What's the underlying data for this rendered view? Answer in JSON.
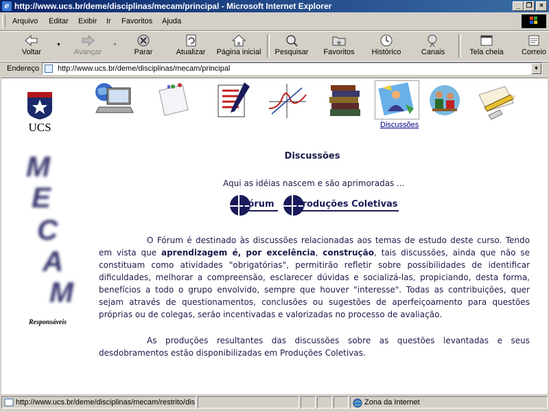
{
  "window": {
    "title": "http://www.ucs.br/deme/disciplinas/mecam/principal - Microsoft Internet Explorer",
    "controls": [
      "_",
      "❐",
      "×"
    ]
  },
  "menu": [
    "Arquivo",
    "Editar",
    "Exibir",
    "Ir",
    "Favoritos",
    "Ajuda"
  ],
  "toolbar": {
    "back": "Voltar",
    "forward": "Avançar",
    "stop": "Parar",
    "refresh": "Atualizar",
    "home": "Página inicial",
    "search": "Pesquisar",
    "favorites": "Favoritos",
    "history": "Histórico",
    "channels": "Canais",
    "fullscreen": "Tela cheia",
    "mail": "Correio"
  },
  "address": {
    "label": "Endereço",
    "url": "http://www.ucs.br/deme/disciplinas/mecam/principal"
  },
  "page": {
    "logo_text": "UCS",
    "side_title_letters": [
      "M",
      "E",
      "C",
      "A",
      "M"
    ],
    "responsaveis": "Responsáveis",
    "nav_icons": [
      "internet-computer-icon",
      "notepad-icon",
      "checklist-icon",
      "graph-icon",
      "books-icon",
      "discussion-icon",
      "people-icon",
      "pencil-paper-icon"
    ],
    "nav_active_label": "Discussões",
    "heading": "Discussões",
    "intro": "Aqui as idéias nascem e são aprimoradas ...",
    "links": {
      "forum": "Fórum",
      "productions": "Produções Coletivas"
    },
    "para1": {
      "start": "O Fórum é destinado às discussões relacionadas aos temas de estudo deste curso. Tendo em vista que ",
      "bold1": "aprendizagem é, por excelência",
      "comma": ", ",
      "bold2": "construção",
      "rest": ", tais discussões, ainda que não se constituam como atividades \"obrigatórias\", permitirão refletir sobre possibilidades de identificar dificuldades, melhorar a compreensão, esclarecer dúvidas e socializá-las, propiciando, desta forma, benefícios a todo o grupo envolvido, sempre que houver \"interesse\". Todas as contribuições, quer sejam através de questionamentos, conclusões ou sugestões de aperfeiçoamento para questões próprias ou de colegas, serão incentivadas e valorizadas no processo de avaliação."
    },
    "para2": "As produções resultantes das discussões sobre as questões levantadas e seus desdobramentos estão disponibilizadas em Produções Coletivas."
  },
  "status": {
    "url": "http://www.ucs.br/deme/disciplinas/mecam/restrito/dis",
    "zone": "Zona da Internet"
  }
}
